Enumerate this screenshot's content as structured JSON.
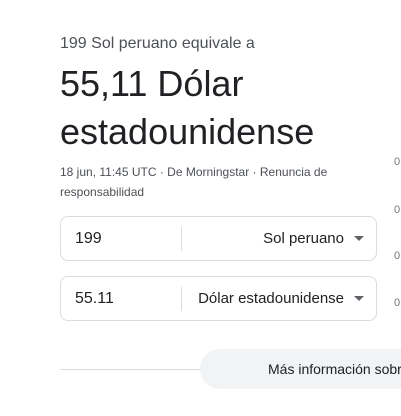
{
  "header": {
    "subtitle": "199 Sol peruano equivale a",
    "result": "55,11 Dólar estadounidense"
  },
  "meta": {
    "timestamp": "18 jun, 11:45 UTC",
    "sep1": " · ",
    "source": "De Morningstar",
    "sep2": " · ",
    "disclaimer": "Renuncia de responsabilidad"
  },
  "converter": {
    "from_amount": "199",
    "from_currency": "Sol peruano",
    "to_amount": "55.11",
    "to_currency": "Dólar estadounidense"
  },
  "chart_ticks": [
    "0",
    "0",
    "0",
    "0"
  ],
  "footer": {
    "more_label": "Más información sobre"
  }
}
